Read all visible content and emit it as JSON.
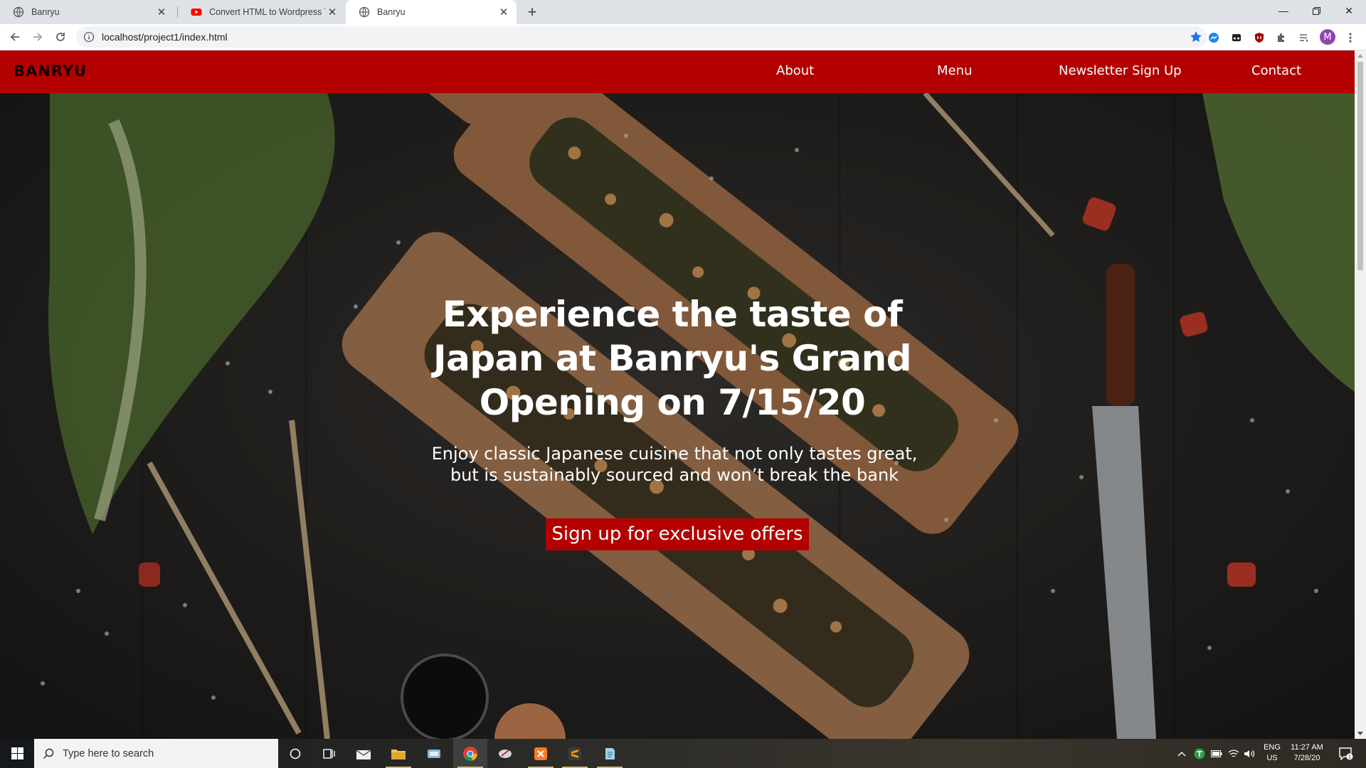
{
  "browser": {
    "tabs": [
      {
        "title": "Banryu",
        "icon": "globe-icon"
      },
      {
        "title": "Convert HTML to Wordpress The",
        "icon": "youtube-icon"
      },
      {
        "title": "Banryu",
        "icon": "globe-icon",
        "active": true
      }
    ],
    "url": "localhost/project1/index.html",
    "profile_initial": "M"
  },
  "site": {
    "brand": "BANRYU",
    "nav": [
      "About",
      "Menu",
      "Newsletter Sign Up",
      "Contact"
    ],
    "hero": {
      "headline": "Experience the taste of Japan at Banryu's Grand Opening on 7/15/20",
      "subline": "Enjoy classic Japanese cuisine that not only tastes great, but is sustainably sourced and won’t break the bank",
      "cta": "Sign up for exclusive offers"
    },
    "colors": {
      "accent": "#b30000",
      "text": "#ffffff"
    }
  },
  "taskbar": {
    "search_placeholder": "Type here to search",
    "lang": "ENG",
    "region": "US",
    "time": "11:27 AM",
    "date": "7/28/20",
    "notification_count": "1"
  }
}
